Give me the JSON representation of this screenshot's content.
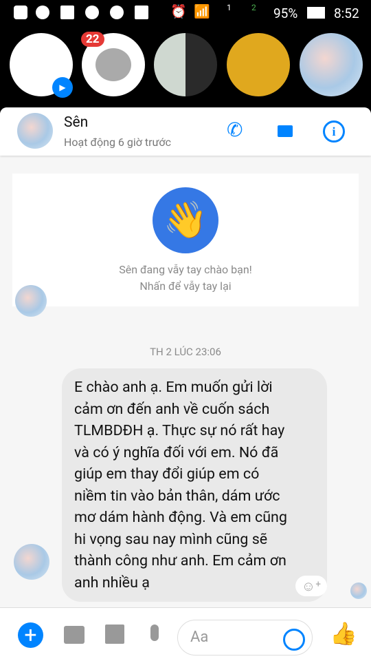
{
  "status_bar": {
    "battery": "95%",
    "time": "8:52",
    "sim1": "1",
    "sim2": "2"
  },
  "chat_heads": {
    "unread_badge": "22"
  },
  "header": {
    "name": "Sên",
    "status": "Hoạt động 6 giờ trước"
  },
  "wave_card": {
    "line1": "Sên đang vẫy tay chào bạn!",
    "line2": "Nhấn để vẫy tay lại"
  },
  "date_separator": "TH 2 LÚC 23:06",
  "message": {
    "lines": [
      "E chào anh ạ. Em muốn gửi lời",
      "cảm ơn đến anh về cuốn sách",
      "TLMBDĐH ạ. Thực sự nó rất hay",
      "và có ý nghĩa đối với em. Nó đã",
      "giúp em thay đổi giúp em có",
      "niềm tin vào bản thân, dám ước",
      "mơ dám hành động. Và em cũng",
      "hi vọng sau nay mình cũng sẽ",
      "thành công như anh. Em cảm ơn",
      "anh nhiều ạ"
    ]
  },
  "composer": {
    "placeholder": "Aa"
  },
  "colors": {
    "accent": "#0084ff",
    "badge": "#e53935"
  }
}
